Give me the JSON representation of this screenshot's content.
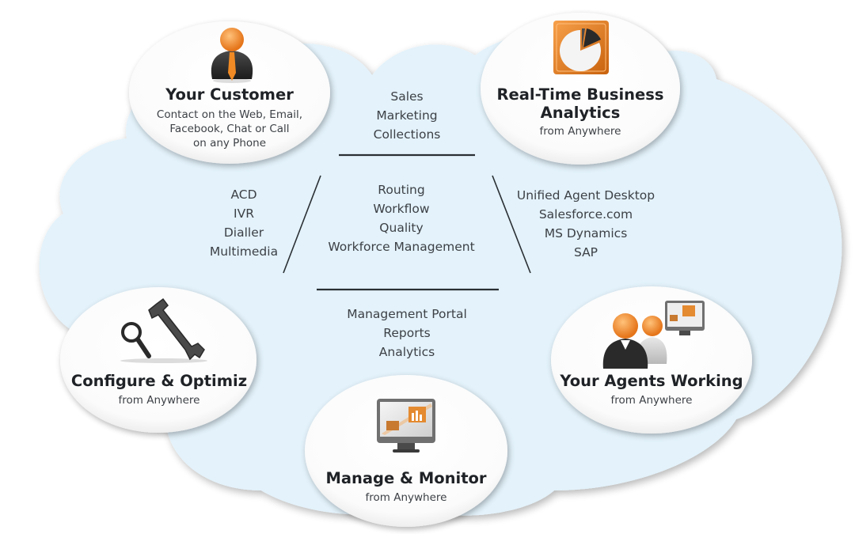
{
  "colors": {
    "cloud_fill": "#e3f2fb",
    "bubble_fill": "#ffffff",
    "accent_orange": "#f08a24",
    "icon_dark": "#2c2c2c",
    "divider": "#2a2f33",
    "text": "#3d4146",
    "title": "#1f2226"
  },
  "nodes": {
    "customer": {
      "icon": "person-icon",
      "title": "Your Customer",
      "lines": [
        "Contact on the Web, Email,",
        "Facebook, Chat or Call",
        "on any Phone"
      ]
    },
    "analytics": {
      "icon": "pie-chart-icon",
      "title_lines": [
        "Real-Time Business",
        "Analytics"
      ],
      "subtitle": "from Anywhere"
    },
    "configure": {
      "icon": "wrench-magnifier-icon",
      "title": "Configure & Optimiz",
      "subtitle": "from Anywhere"
    },
    "manage": {
      "icon": "monitor-chart-icon",
      "title": "Manage & Monitor",
      "subtitle": "from Anywhere"
    },
    "agents": {
      "icon": "agents-monitor-icon",
      "title": "Your Agents Working",
      "subtitle": "from Anywhere"
    }
  },
  "groups": {
    "top": [
      "Sales",
      "Marketing",
      "Collections"
    ],
    "left": [
      "ACD",
      "IVR",
      "Dialler",
      "Multimedia"
    ],
    "center": [
      "Routing",
      "Workflow",
      "Quality",
      "Workforce Management"
    ],
    "right": [
      "Unified Agent Desktop",
      "Salesforce.com",
      "MS Dynamics",
      "SAP"
    ],
    "bottom": [
      "Management Portal",
      "Reports",
      "Analytics"
    ]
  }
}
